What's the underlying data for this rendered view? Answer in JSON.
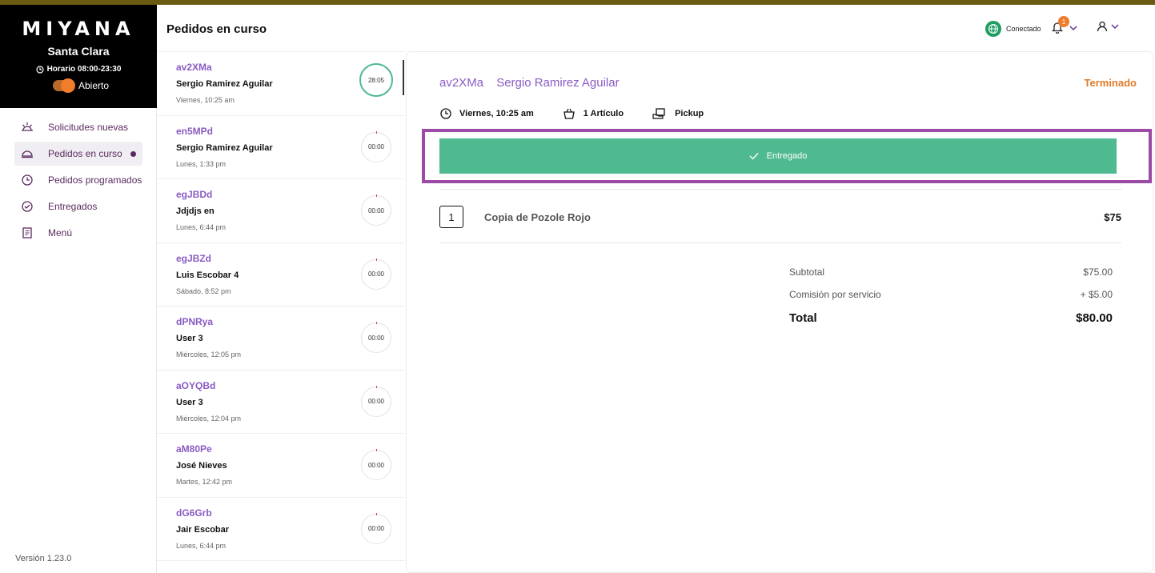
{
  "brand": {
    "logo": "MIYANA",
    "store": "Santa Clara",
    "hours": "Horario 08:00-23:30",
    "open_label": "Abierto"
  },
  "nav": [
    {
      "label": "Solicitudes nuevas",
      "icon": "sunrise-icon"
    },
    {
      "label": "Pedidos en curso",
      "icon": "dish-icon",
      "active": true
    },
    {
      "label": "Pedidos programados",
      "icon": "clock-icon"
    },
    {
      "label": "Entregados",
      "icon": "check-circle-icon"
    },
    {
      "label": "Menú",
      "icon": "menu-book-icon"
    }
  ],
  "version": "Versión 1.23.0",
  "header": {
    "title": "Pedidos en curso",
    "connection": "Conectado",
    "notifications": "1"
  },
  "orders": [
    {
      "code": "av2XMa",
      "name": "Sergio Ramirez Aguilar",
      "when": "Viernes, 10:25 am",
      "timer": "28:05"
    },
    {
      "code": "en5MPd",
      "name": "Sergio Ramirez Aguilar",
      "when": "Lunes, 1:33 pm",
      "timer": "00:00"
    },
    {
      "code": "egJBDd",
      "name": "Jdjdjs en",
      "when": "Lunes, 6:44 pm",
      "timer": "00:00"
    },
    {
      "code": "egJBZd",
      "name": "Luis Escobar 4",
      "when": "Sábado, 8:52 pm",
      "timer": "00:00"
    },
    {
      "code": "dPNRya",
      "name": "User 3",
      "when": "Miércoles, 12:05 pm",
      "timer": "00:00"
    },
    {
      "code": "aOYQBd",
      "name": "User 3",
      "when": "Miércoles, 12:04 pm",
      "timer": "00:00"
    },
    {
      "code": "aM80Pe",
      "name": "José Nieves",
      "when": "Martes, 12:42 pm",
      "timer": "00:00"
    },
    {
      "code": "dG6Grb",
      "name": "Jair Escobar",
      "when": "Lunes, 6:44 pm",
      "timer": "00:00"
    }
  ],
  "detail": {
    "code": "av2XMa",
    "customer": "Sergio Ramirez Aguilar",
    "status": "Terminado",
    "time": "Viernes, 10:25 am",
    "items_count": "1 Artículo",
    "mode": "Pickup",
    "action": "Entregado",
    "items": [
      {
        "qty": "1",
        "name": "Copia de Pozole Rojo",
        "price": "$75"
      }
    ],
    "totals": {
      "subtotal_label": "Subtotal",
      "subtotal": "$75.00",
      "fee_label": "Comisión por servicio",
      "fee": "+ $5.00",
      "total_label": "Total",
      "total": "$80.00"
    }
  },
  "colors": {
    "accent": "#8a5bc4",
    "success": "#4fb98f",
    "warning": "#e07b2a",
    "highlight": "#9b4ba5"
  }
}
